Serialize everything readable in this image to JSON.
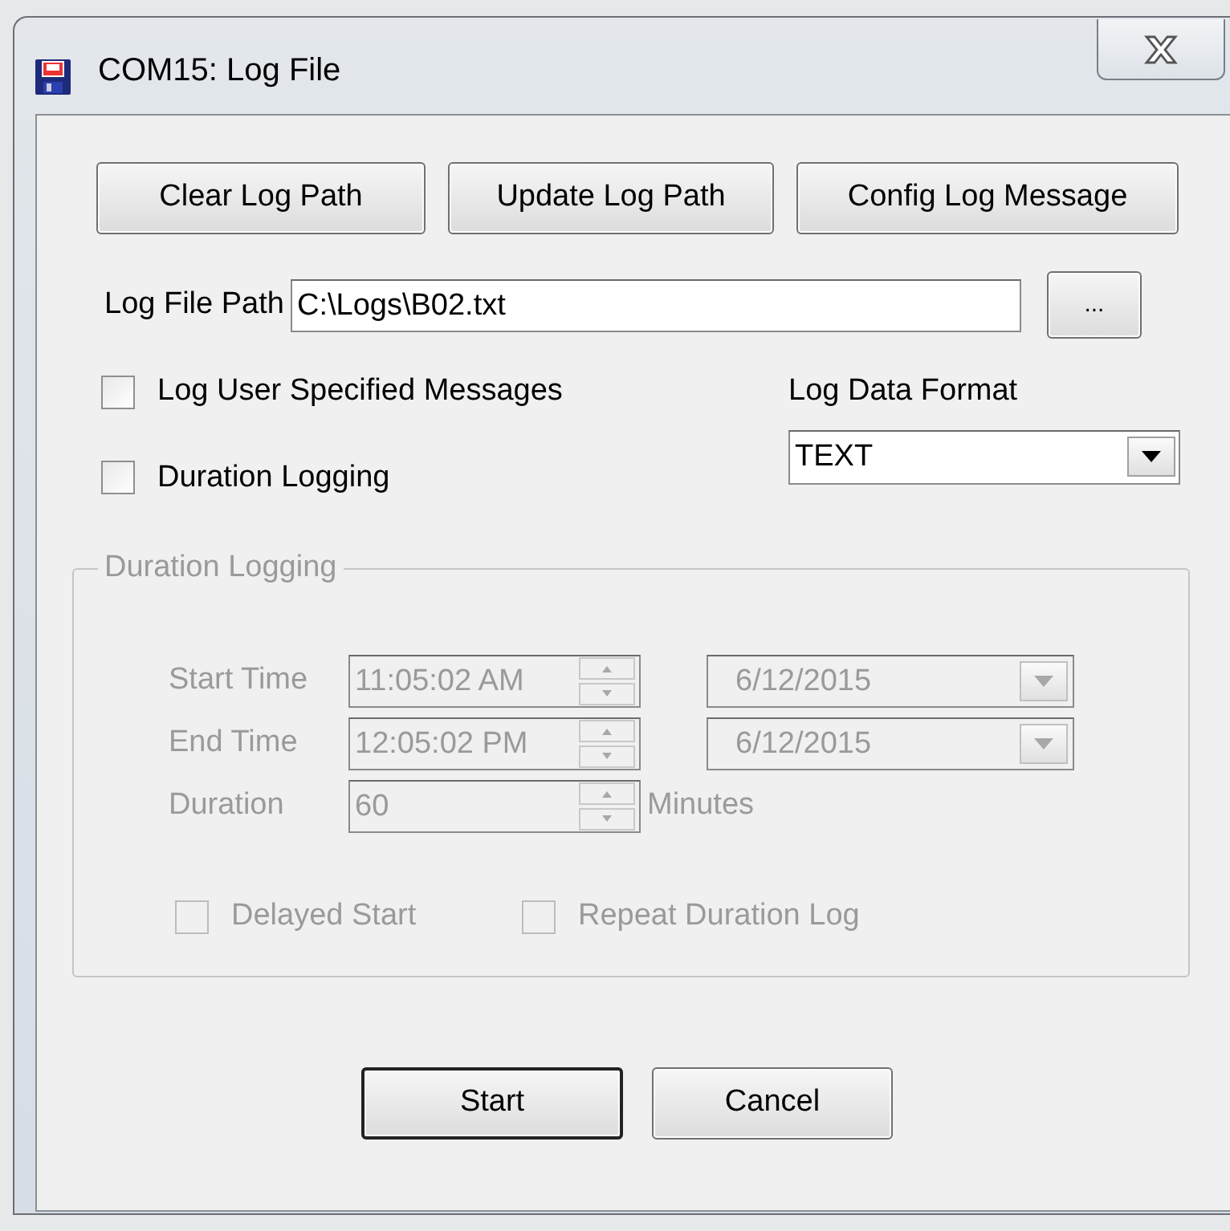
{
  "window": {
    "title": "COM15: Log File"
  },
  "toolbar_buttons": [
    "Clear Log Path",
    "Update Log Path",
    "Config Log Message"
  ],
  "log_file_path": {
    "label": "Log File Path",
    "value": "C:\\Logs\\B02.txt",
    "browse_button": "..."
  },
  "options": [
    {
      "label": "Log User Specified Messages",
      "checked": false
    },
    {
      "label": "Duration Logging",
      "checked": false
    }
  ],
  "log_data_format": {
    "label": "Log Data Format",
    "value": "TEXT"
  },
  "duration_group": {
    "title": "Duration Logging",
    "disabled": true,
    "rows": [
      {
        "kind": "time",
        "label": "Start Time",
        "value": "11:05:02 AM",
        "date": "6/12/2015"
      },
      {
        "kind": "time",
        "label": "End Time",
        "value": "12:05:02 PM",
        "date": "6/12/2015"
      },
      {
        "kind": "number",
        "label": "Duration",
        "value": "60",
        "unit": "Minutes"
      }
    ],
    "checkboxes": [
      {
        "label": "Delayed Start",
        "checked": false
      },
      {
        "label": "Repeat Duration Log",
        "checked": false
      }
    ]
  },
  "buttons": [
    {
      "label": "Start",
      "default": true
    },
    {
      "label": "Cancel",
      "default": false
    }
  ]
}
